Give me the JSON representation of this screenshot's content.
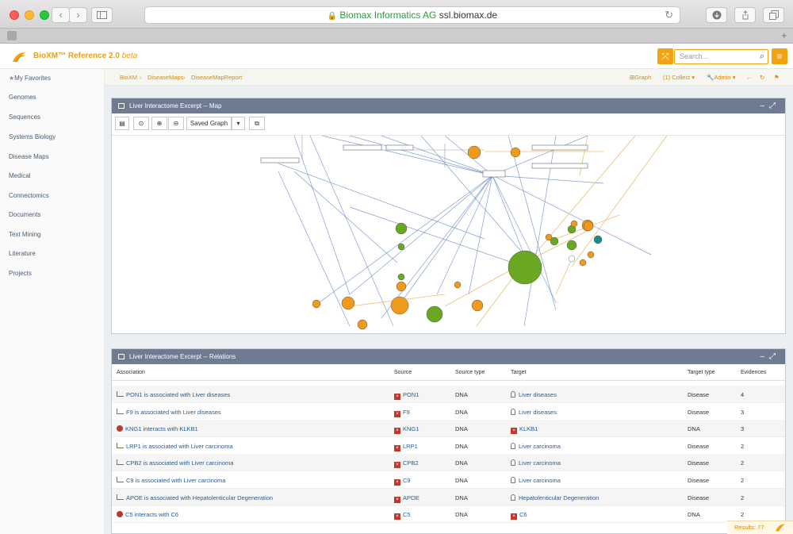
{
  "browser": {
    "url_host": "Biomax Informatics AG",
    "url_domain": "ssl.biomax.de"
  },
  "app": {
    "title": "BioXM™ Reference 2.0",
    "beta": "beta",
    "search_placeholder": "Search..."
  },
  "sidebar": {
    "items": [
      {
        "label": "My Favorites"
      },
      {
        "label": "Genomes"
      },
      {
        "label": "Sequences"
      },
      {
        "label": "Systems Biology"
      },
      {
        "label": "Disease Maps"
      },
      {
        "label": "Medical"
      },
      {
        "label": "Connectomics"
      },
      {
        "label": "Documents"
      },
      {
        "label": "Text Mining"
      },
      {
        "label": "Literature"
      },
      {
        "label": "Projects"
      }
    ]
  },
  "breadcrumb": {
    "items": [
      "BioXM",
      "DiseaseMaps",
      "DiseaseMapReport"
    ],
    "actions": {
      "graph": "Graph",
      "collect": "(1) Collect",
      "admin": "Admin"
    }
  },
  "map_panel": {
    "title": "Liver Interactome Excerpt -- Map",
    "saved_graph": "Saved Graph"
  },
  "relations_panel": {
    "title": "Liver Interactome Excerpt -- Relations",
    "columns": [
      "Association",
      "Source",
      "Source type",
      "Target",
      "Target type",
      "Evidences"
    ],
    "rows": [
      {
        "association": "PON1 is associated with Liver diseases",
        "kind": "assoc",
        "source": "PON1",
        "source_type": "DNA",
        "target": "Liver diseases",
        "target_kind": "disease",
        "target_type": "Disease",
        "evidences": "4"
      },
      {
        "association": "F9 is associated with Liver diseases",
        "kind": "assoc",
        "source": "F9",
        "source_type": "DNA",
        "target": "Liver diseases",
        "target_kind": "disease",
        "target_type": "Disease",
        "evidences": "3"
      },
      {
        "association": "KNG1 interacts with KLKB1",
        "kind": "interact",
        "source": "KNG1",
        "source_type": "DNA",
        "target": "KLKB1",
        "target_kind": "gene",
        "target_type": "DNA",
        "evidences": "3"
      },
      {
        "association": "LRP1 is associated with Liver carcinoma",
        "kind": "assoc",
        "source": "LRP1",
        "source_type": "DNA",
        "target": "Liver carcinoma",
        "target_kind": "disease",
        "target_type": "Disease",
        "evidences": "2"
      },
      {
        "association": "CPB2 is associated with Liver carcinoma",
        "kind": "assoc",
        "source": "CPB2",
        "source_type": "DNA",
        "target": "Liver carcinoma",
        "target_kind": "disease",
        "target_type": "Disease",
        "evidences": "2"
      },
      {
        "association": "C9 is associated with Liver carcinoma",
        "kind": "assoc",
        "source": "C9",
        "source_type": "DNA",
        "target": "Liver carcinoma",
        "target_kind": "disease",
        "target_type": "Disease",
        "evidences": "2"
      },
      {
        "association": "APOE is associated with Hepatolenticular Degeneration",
        "kind": "assoc",
        "source": "APOE",
        "source_type": "DNA",
        "target": "Hepatolenticular Degeneration",
        "target_kind": "disease",
        "target_type": "Disease",
        "evidences": "2"
      },
      {
        "association": "C5 interacts with C6",
        "kind": "interact",
        "source": "C5",
        "source_type": "DNA",
        "target": "C6",
        "target_kind": "gene",
        "target_type": "DNA",
        "evidences": "2"
      }
    ],
    "results": "Results: 77"
  },
  "colors": {
    "accent": "#f2a313",
    "panel_header": "#6f7b91",
    "node_orange": "#ef9a1a",
    "node_green": "#6aa821",
    "node_teal": "#1b8c8c",
    "edge_blue": "#5a7fc6",
    "edge_gold": "#e8b25a",
    "link_blue": "#2a5b93"
  }
}
